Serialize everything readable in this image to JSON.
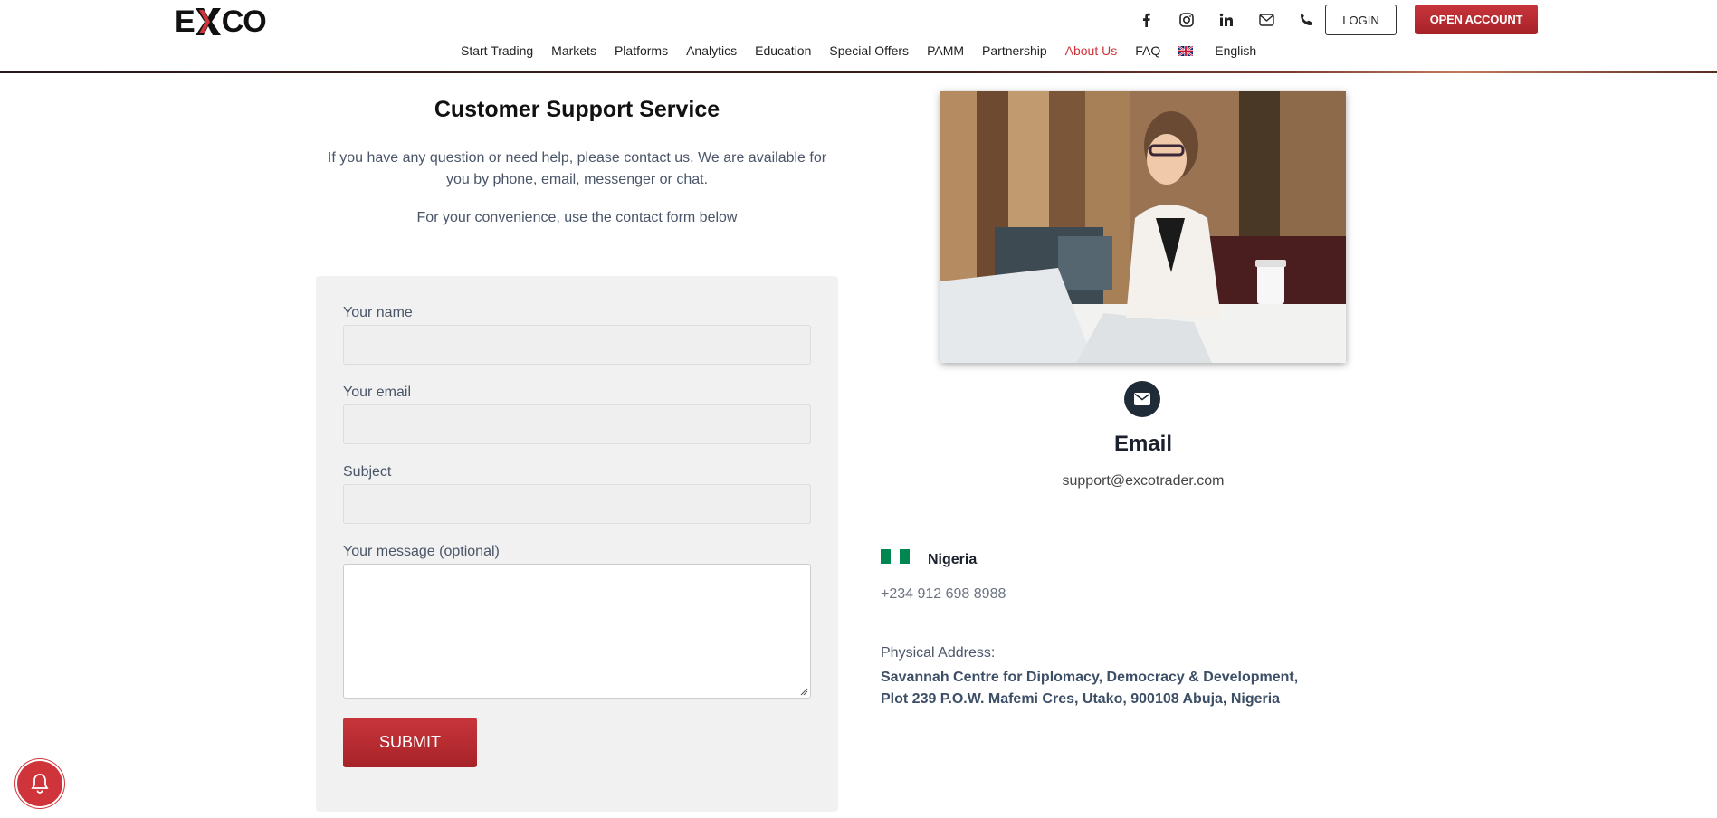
{
  "header": {
    "logo_text": "EXCO",
    "social_icons": [
      "facebook-icon",
      "instagram-icon",
      "linkedin-icon",
      "email-icon",
      "phone-icon"
    ],
    "login_label": "LOGIN",
    "open_account_label": "OPEN ACCOUNT"
  },
  "nav": {
    "items": [
      {
        "label": "Start Trading"
      },
      {
        "label": "Markets"
      },
      {
        "label": "Platforms"
      },
      {
        "label": "Analytics"
      },
      {
        "label": "Education"
      },
      {
        "label": "Special Offers"
      },
      {
        "label": "PAMM"
      },
      {
        "label": "Partnership"
      },
      {
        "label": "About Us",
        "active": true
      },
      {
        "label": "FAQ"
      },
      {
        "label": "English"
      }
    ]
  },
  "support": {
    "title": "Customer Support Service",
    "intro": "If you have any question or need help, please contact us. We are available for you by phone, email, messenger or chat.",
    "convenience": "For your convenience, use the contact form below"
  },
  "form": {
    "name_label": "Your name",
    "name_value": "",
    "email_label": "Your email",
    "email_value": "",
    "subject_label": "Subject",
    "subject_value": "",
    "message_label": "Your message (optional)",
    "message_value": "",
    "submit_label": "SUBMIT"
  },
  "contact": {
    "email_title": "Email",
    "email_address": "support@excotrader.com",
    "country": "Nigeria",
    "phone": "+234 912 698 8988",
    "address_label": "Physical Address:",
    "address_line1": "Savannah Centre for Diplomacy, Democracy & Development,",
    "address_line2": "Plot 239 P.O.W. Mafemi Cres, Utako, 900108 Abuja, Nigeria"
  },
  "colors": {
    "brand_red": "#c8353b",
    "nav_active": "#d0343b",
    "nigeria_green": "#008751"
  }
}
